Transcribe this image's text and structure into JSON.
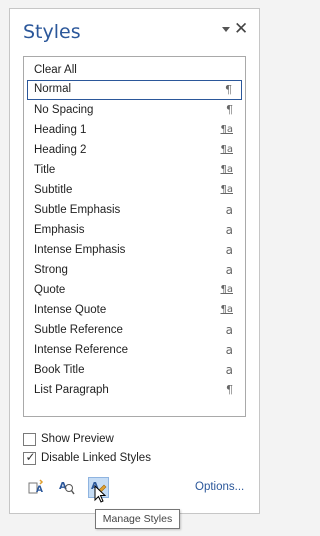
{
  "pane": {
    "title": "Styles",
    "dropdown_icon": "chevron-down-icon",
    "close_icon": "close-icon",
    "close_glyph": "✕"
  },
  "styles": [
    {
      "name": "Clear All",
      "mark": ""
    },
    {
      "name": "Normal",
      "mark": "¶",
      "selected": true
    },
    {
      "name": "No Spacing",
      "mark": "¶"
    },
    {
      "name": "Heading 1",
      "mark": "¶a"
    },
    {
      "name": "Heading 2",
      "mark": "¶a"
    },
    {
      "name": "Title",
      "mark": "¶a"
    },
    {
      "name": "Subtitle",
      "mark": "¶a"
    },
    {
      "name": "Subtle Emphasis",
      "mark": "a"
    },
    {
      "name": "Emphasis",
      "mark": "a"
    },
    {
      "name": "Intense Emphasis",
      "mark": "a"
    },
    {
      "name": "Strong",
      "mark": "a"
    },
    {
      "name": "Quote",
      "mark": "¶a"
    },
    {
      "name": "Intense Quote",
      "mark": "¶a"
    },
    {
      "name": "Subtle Reference",
      "mark": "a"
    },
    {
      "name": "Intense Reference",
      "mark": "a"
    },
    {
      "name": "Book Title",
      "mark": "a"
    },
    {
      "name": "List Paragraph",
      "mark": "¶"
    }
  ],
  "options": {
    "show_preview": {
      "label": "Show Preview",
      "checked": false
    },
    "disable_linked": {
      "label": "Disable Linked Styles",
      "checked": true,
      "check_glyph": "✓"
    }
  },
  "toolbar": {
    "new_style_icon": "new-style-icon",
    "style_inspector_icon": "style-inspector-icon",
    "manage_styles_icon": "manage-styles-icon",
    "options_label": "Options..."
  },
  "tooltip": {
    "text": "Manage Styles"
  },
  "colors": {
    "accent": "#2b579a",
    "active_button": "#c5dcf5"
  }
}
